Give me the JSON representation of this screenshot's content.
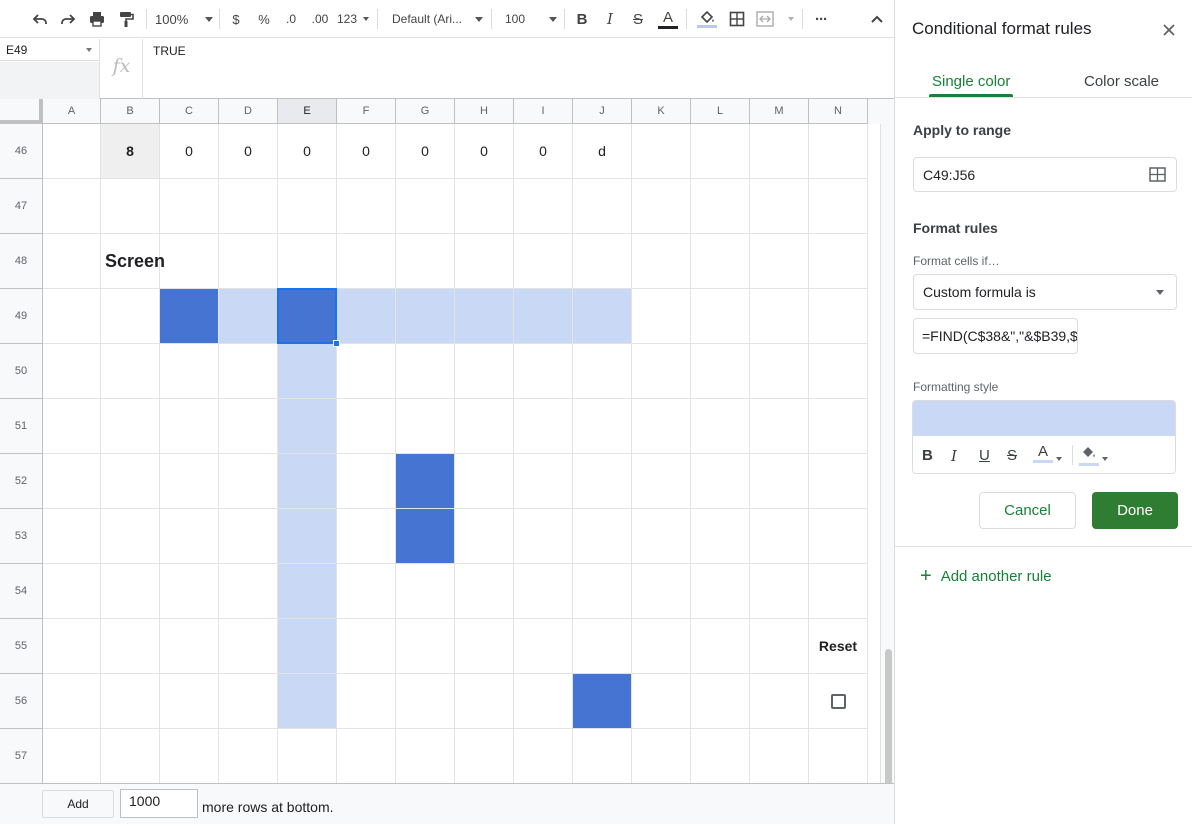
{
  "toolbar": {
    "zoom": "100%",
    "currency": "$",
    "percent": "%",
    "decrease_decimal": ".0",
    "increase_decimal": ".00",
    "number_format": "123",
    "font": "Default (Ari...",
    "font_size": "100",
    "bold": "B",
    "italic": "I",
    "strikethrough": "S",
    "text_color": "A",
    "more": "···"
  },
  "formula_bar": {
    "cell_ref": "E49",
    "fx": "fx",
    "value": "TRUE"
  },
  "grid": {
    "columns": [
      "A",
      "B",
      "C",
      "D",
      "E",
      "F",
      "G",
      "H",
      "I",
      "J",
      "K",
      "L",
      "M",
      "N"
    ],
    "selected_column": "E",
    "rows": [
      "46",
      "47",
      "48",
      "49",
      "50",
      "51",
      "52",
      "53",
      "54",
      "55",
      "56",
      "57"
    ],
    "row46_values": [
      "",
      "8",
      "0",
      "0",
      "0",
      "0",
      "0",
      "0",
      "0",
      "d",
      "",
      "",
      "",
      ""
    ],
    "screen_label": "Screen",
    "reset_label": "Reset",
    "reset_checked": false,
    "colors": {
      "highlight_light": "#c9d8f4",
      "highlight_dark": "#4674d3",
      "selection": "#1a73e8"
    }
  },
  "bottom_bar": {
    "add_button": "Add",
    "rows_value": "1000",
    "rows_label": "more rows at bottom."
  },
  "panel": {
    "title": "Conditional format rules",
    "tabs": {
      "single_color": "Single color",
      "color_scale": "Color scale"
    },
    "apply_to_range_label": "Apply to range",
    "range": "C49:J56",
    "format_rules_label": "Format rules",
    "format_cells_if_label": "Format cells if…",
    "condition": "Custom formula is",
    "formula": "=FIND(C$38&\",\"&$B39,$",
    "formatting_style_label": "Formatting style",
    "style": {
      "bold": "B",
      "italic": "I",
      "underline": "U",
      "strikethrough": "S",
      "text_color": "A"
    },
    "cancel": "Cancel",
    "done": "Done",
    "add_rule": "Add another rule",
    "add_rule_icon": "+",
    "accent_color": "#188038"
  }
}
